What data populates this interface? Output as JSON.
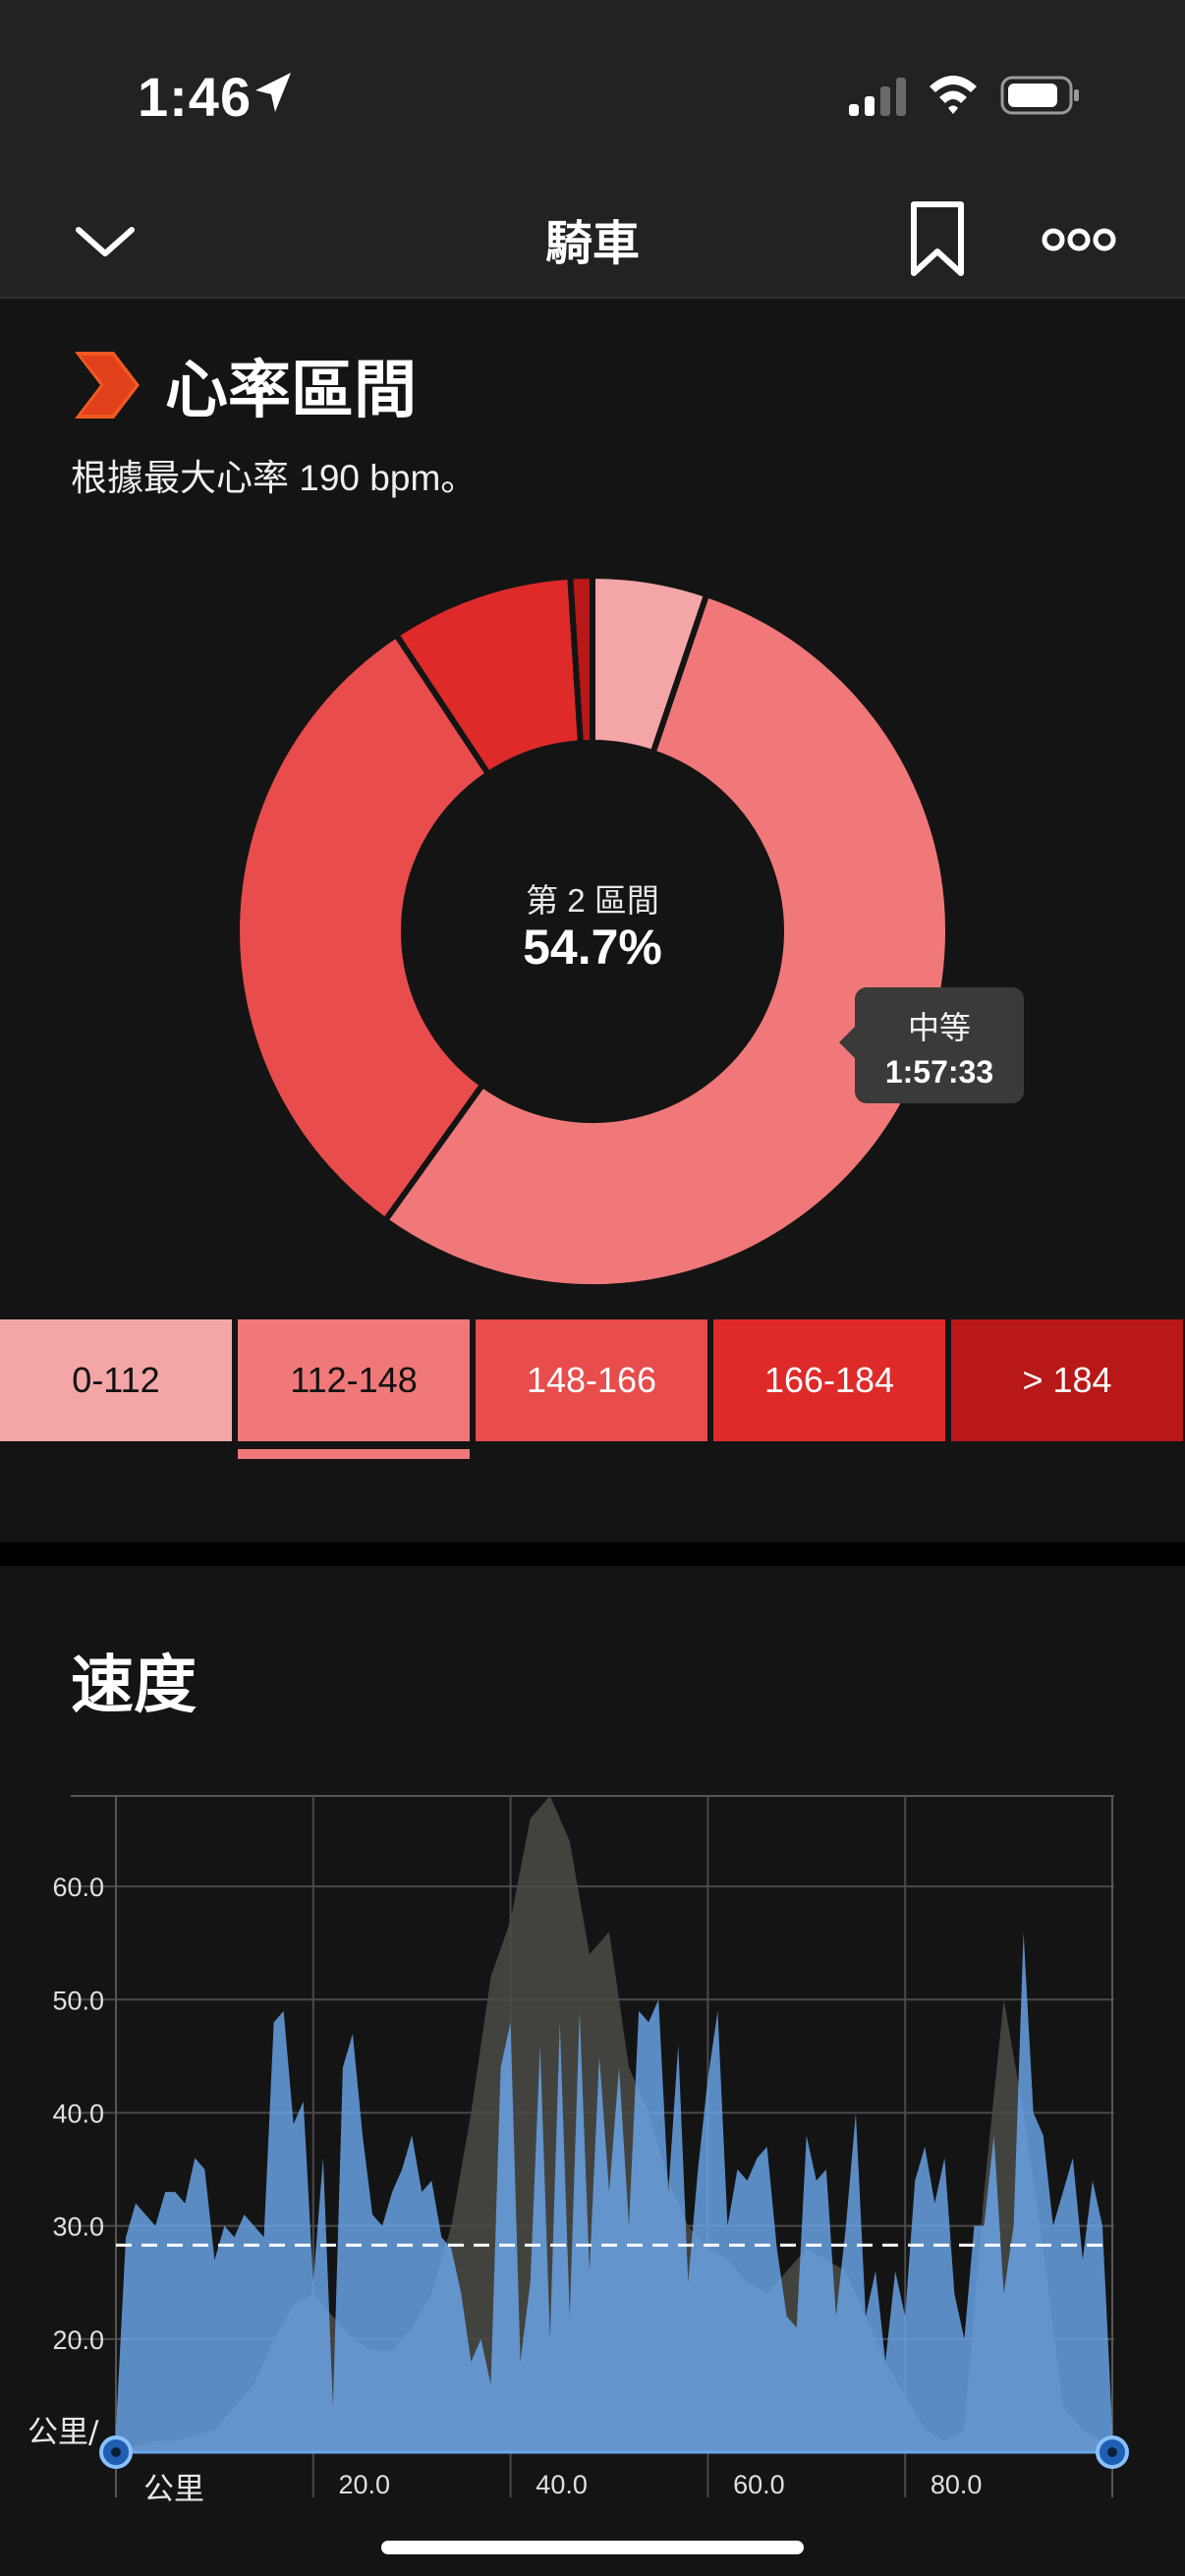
{
  "status_bar": {
    "time": "1:46"
  },
  "nav": {
    "title": "騎車"
  },
  "heart_rate": {
    "title": "心率區間",
    "subtitle": "根據最大心率 190 bpm。",
    "center_label": "第 2 區間",
    "center_value": "54.7%",
    "tooltip_label": "中等",
    "tooltip_value": "1:57:33",
    "zones": [
      {
        "label": "0-112",
        "color": "#f4a5a5",
        "text_color": "#111111",
        "percent": 5.2
      },
      {
        "label": "112-148",
        "color": "#f07878",
        "text_color": "#111111",
        "percent": 54.7,
        "selected": true
      },
      {
        "label": "148-166",
        "color": "#e84c4c",
        "text_color": "#ffffff",
        "percent": 30.8
      },
      {
        "label": "166-184",
        "color": "#df2a2a",
        "text_color": "#ffffff",
        "percent": 8.3
      },
      {
        "label": "> 184",
        "color": "#b81818",
        "text_color": "#ffffff",
        "percent": 1.0
      }
    ]
  },
  "speed": {
    "title": "速度",
    "chart_data": {
      "type": "area",
      "y_axis_label": "公里/",
      "x_axis_label": "公里",
      "yticks": [
        "60.0",
        "50.0",
        "40.0",
        "30.0",
        "20.0"
      ],
      "xticks": [
        "20.0",
        "40.0",
        "60.0",
        "80.0"
      ],
      "ylim": [
        10,
        68
      ],
      "xlim": [
        0,
        101
      ],
      "average_speed": 28.3,
      "speed_color": "#6aa6ea",
      "elevation_color": "#4a4a46",
      "speed_series": [
        [
          0,
          12
        ],
        [
          1,
          29
        ],
        [
          2,
          32
        ],
        [
          3,
          31
        ],
        [
          4,
          30
        ],
        [
          5,
          33
        ],
        [
          6,
          33
        ],
        [
          7,
          32
        ],
        [
          8,
          36
        ],
        [
          9,
          35
        ],
        [
          10,
          27
        ],
        [
          11,
          30
        ],
        [
          12,
          29
        ],
        [
          13,
          31
        ],
        [
          14,
          30
        ],
        [
          15,
          29
        ],
        [
          16,
          48
        ],
        [
          17,
          49
        ],
        [
          18,
          39
        ],
        [
          19,
          41
        ],
        [
          20,
          25
        ],
        [
          21,
          36
        ],
        [
          22,
          14
        ],
        [
          23,
          44
        ],
        [
          24,
          47
        ],
        [
          25,
          38
        ],
        [
          26,
          31
        ],
        [
          27,
          30
        ],
        [
          28,
          33
        ],
        [
          29,
          35
        ],
        [
          30,
          38
        ],
        [
          31,
          33
        ],
        [
          32,
          34
        ],
        [
          33,
          29
        ],
        [
          34,
          28
        ],
        [
          35,
          24
        ],
        [
          36,
          18
        ],
        [
          37,
          20
        ],
        [
          38,
          16
        ],
        [
          39,
          44
        ],
        [
          40,
          48
        ],
        [
          41,
          18
        ],
        [
          42,
          25
        ],
        [
          43,
          46
        ],
        [
          44,
          20
        ],
        [
          45,
          48
        ],
        [
          46,
          22
        ],
        [
          47,
          49
        ],
        [
          48,
          26
        ],
        [
          49,
          45
        ],
        [
          50,
          33
        ],
        [
          51,
          44
        ],
        [
          52,
          30
        ],
        [
          53,
          49
        ],
        [
          54,
          48
        ],
        [
          55,
          50
        ],
        [
          56,
          33
        ],
        [
          57,
          46
        ],
        [
          58,
          25
        ],
        [
          59,
          35
        ],
        [
          60,
          43
        ],
        [
          61,
          49
        ],
        [
          62,
          30
        ],
        [
          63,
          35
        ],
        [
          64,
          34
        ],
        [
          65,
          36
        ],
        [
          66,
          37
        ],
        [
          67,
          28
        ],
        [
          68,
          22
        ],
        [
          69,
          21
        ],
        [
          70,
          38
        ],
        [
          71,
          34
        ],
        [
          72,
          35
        ],
        [
          73,
          22
        ],
        [
          74,
          30
        ],
        [
          75,
          40
        ],
        [
          76,
          22
        ],
        [
          77,
          26
        ],
        [
          78,
          18
        ],
        [
          79,
          26
        ],
        [
          80,
          22
        ],
        [
          81,
          34
        ],
        [
          82,
          37
        ],
        [
          83,
          32
        ],
        [
          84,
          36
        ],
        [
          85,
          24
        ],
        [
          86,
          20
        ],
        [
          87,
          30
        ],
        [
          88,
          30
        ],
        [
          89,
          38
        ],
        [
          90,
          24
        ],
        [
          91,
          30
        ],
        [
          92,
          56
        ],
        [
          93,
          40
        ],
        [
          94,
          38
        ],
        [
          95,
          30
        ],
        [
          96,
          33
        ],
        [
          97,
          36
        ],
        [
          98,
          27
        ],
        [
          99,
          34
        ],
        [
          100,
          30
        ],
        [
          101,
          12
        ]
      ],
      "elevation_series": [
        [
          0,
          10
        ],
        [
          2,
          10.5
        ],
        [
          4,
          11
        ],
        [
          6,
          11
        ],
        [
          8,
          11.5
        ],
        [
          10,
          12
        ],
        [
          12,
          14
        ],
        [
          14,
          16
        ],
        [
          16,
          20
        ],
        [
          18,
          23
        ],
        [
          20,
          24
        ],
        [
          22,
          22
        ],
        [
          24,
          20
        ],
        [
          26,
          19
        ],
        [
          28,
          19
        ],
        [
          30,
          21
        ],
        [
          32,
          24
        ],
        [
          34,
          30
        ],
        [
          36,
          40
        ],
        [
          38,
          52
        ],
        [
          40,
          57
        ],
        [
          42,
          66
        ],
        [
          44,
          68
        ],
        [
          46,
          64
        ],
        [
          48,
          54
        ],
        [
          50,
          56
        ],
        [
          52,
          44
        ],
        [
          54,
          40
        ],
        [
          56,
          34
        ],
        [
          58,
          30
        ],
        [
          60,
          28
        ],
        [
          62,
          27
        ],
        [
          64,
          25
        ],
        [
          66,
          24
        ],
        [
          68,
          26
        ],
        [
          70,
          28
        ],
        [
          72,
          27
        ],
        [
          74,
          26
        ],
        [
          76,
          22
        ],
        [
          78,
          18
        ],
        [
          80,
          15
        ],
        [
          82,
          12
        ],
        [
          84,
          11
        ],
        [
          86,
          12
        ],
        [
          88,
          33
        ],
        [
          90,
          50
        ],
        [
          92,
          40
        ],
        [
          94,
          28
        ],
        [
          96,
          14
        ],
        [
          98,
          12
        ],
        [
          100,
          11
        ],
        [
          101,
          10
        ]
      ]
    }
  }
}
